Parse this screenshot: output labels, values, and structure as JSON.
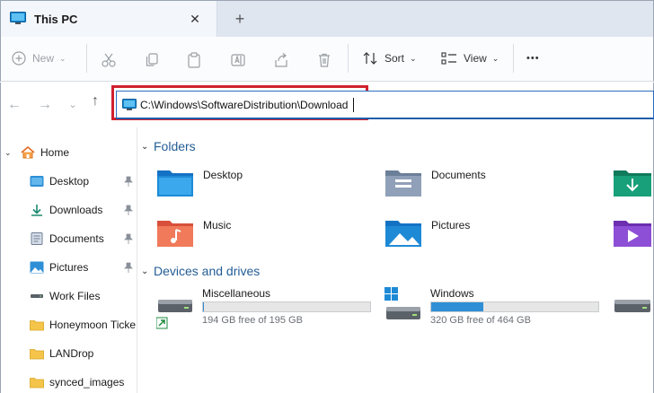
{
  "window": {
    "tab_title": "This PC",
    "close_tab_glyph": "✕",
    "new_tab_glyph": "+"
  },
  "toolbar": {
    "new_label": "New",
    "sort_label": "Sort",
    "view_label": "View",
    "more_glyph": "•••"
  },
  "address": {
    "path": "C:\\Windows\\SoftwareDistribution\\Download",
    "highlight_color": "#d1202d"
  },
  "sidebar": {
    "items": [
      {
        "label": "Home"
      },
      {
        "label": "Desktop"
      },
      {
        "label": "Downloads"
      },
      {
        "label": "Documents"
      },
      {
        "label": "Pictures"
      },
      {
        "label": "Work Files"
      },
      {
        "label": "Honeymoon Ticke"
      },
      {
        "label": "LANDrop"
      },
      {
        "label": "synced_images"
      }
    ]
  },
  "main": {
    "folders_heading": "Folders",
    "folders": [
      {
        "label": "Desktop"
      },
      {
        "label": "Documents"
      },
      {
        "label": "Music"
      },
      {
        "label": "Pictures"
      }
    ],
    "devices_heading": "Devices and drives",
    "drives": [
      {
        "name": "Miscellaneous",
        "free": "194 GB free of 195 GB",
        "used_fraction": 0.005
      },
      {
        "name": "Windows",
        "free": "320 GB free of 464 GB",
        "used_fraction": 0.31
      }
    ]
  },
  "colors": {
    "accent": "#2e8fd6",
    "folder_blue": "#1e8ad6",
    "heading_blue": "#245d96"
  }
}
